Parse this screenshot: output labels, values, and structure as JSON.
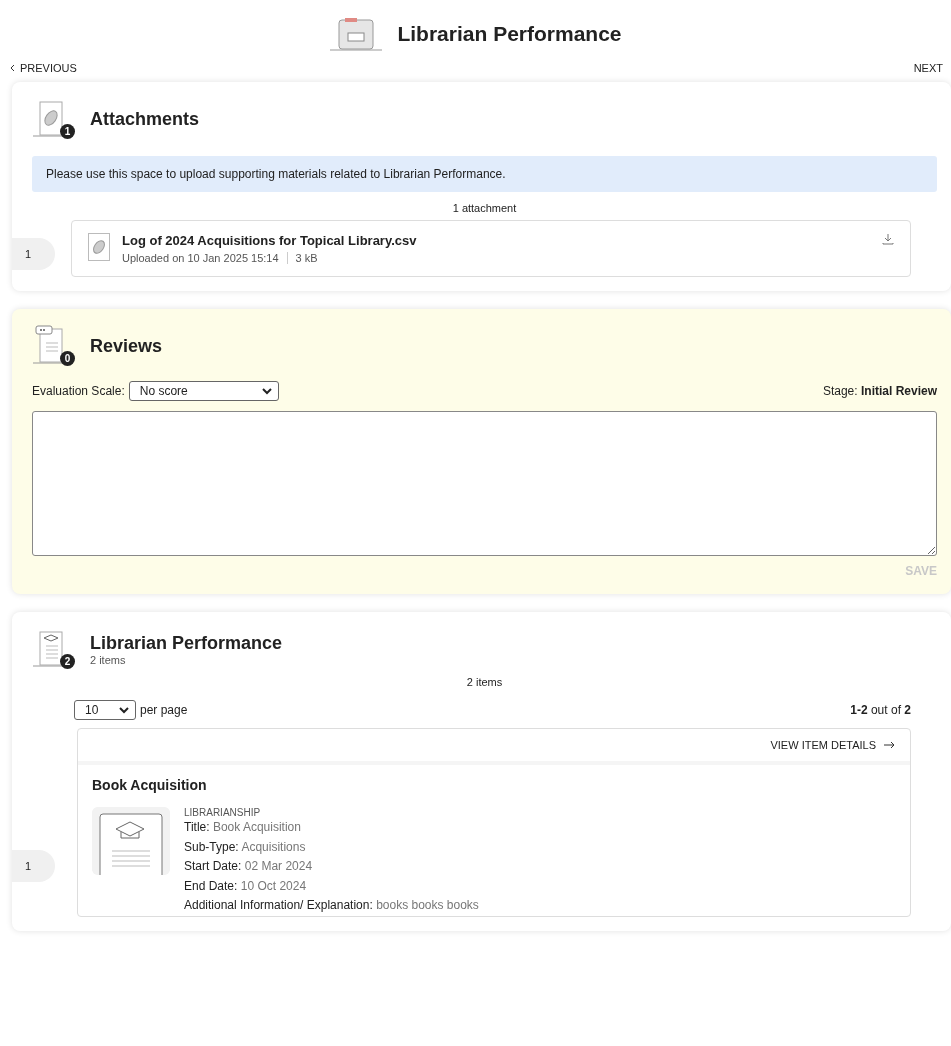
{
  "page": {
    "title": "Librarian Performance"
  },
  "nav": {
    "previous": "PREVIOUS",
    "next": "NEXT"
  },
  "attachments": {
    "title": "Attachments",
    "badge": "1",
    "notice": "Please use this space to upload supporting materials related to Librarian Performance.",
    "count_label": "1 attachment",
    "files": [
      {
        "index": "1",
        "name": "Log of 2024 Acquisitions for Topical Library.csv",
        "uploaded": "Uploaded on 10 Jan 2025 15:14",
        "size": "3 kB"
      }
    ]
  },
  "reviews": {
    "title": "Reviews",
    "badge": "0",
    "scale_label": "Evaluation Scale:",
    "scale_value": "No score",
    "stage": "Stage: **Initial Review**",
    "save": {
      "label": "SAVE",
      "disabled": true
    }
  },
  "performance": {
    "title": "Librarian Performance",
    "subtitle": "2 items",
    "badge": "2",
    "count_label": "2 items",
    "per_page": "10",
    "per_page_label": "per page",
    "range": "**1-2** out of **2**",
    "view_details": "VIEW ITEM DETAILS",
    "items": [
      {
        "index": "1",
        "title": "Book Acquisition",
        "category": "LIBRARIANSHIP",
        "fields": [
          {
            "label": "Title:",
            "value": "Book Acquisition"
          },
          {
            "label": "Sub-Type:",
            "value": "Acquisitions"
          },
          {
            "label": "Start Date:",
            "value": "02 Mar 2024"
          },
          {
            "label": "End Date:",
            "value": "10 Oct 2024"
          },
          {
            "label": "Additional Information/ Explanation:",
            "value": "books books books"
          }
        ]
      }
    ]
  }
}
